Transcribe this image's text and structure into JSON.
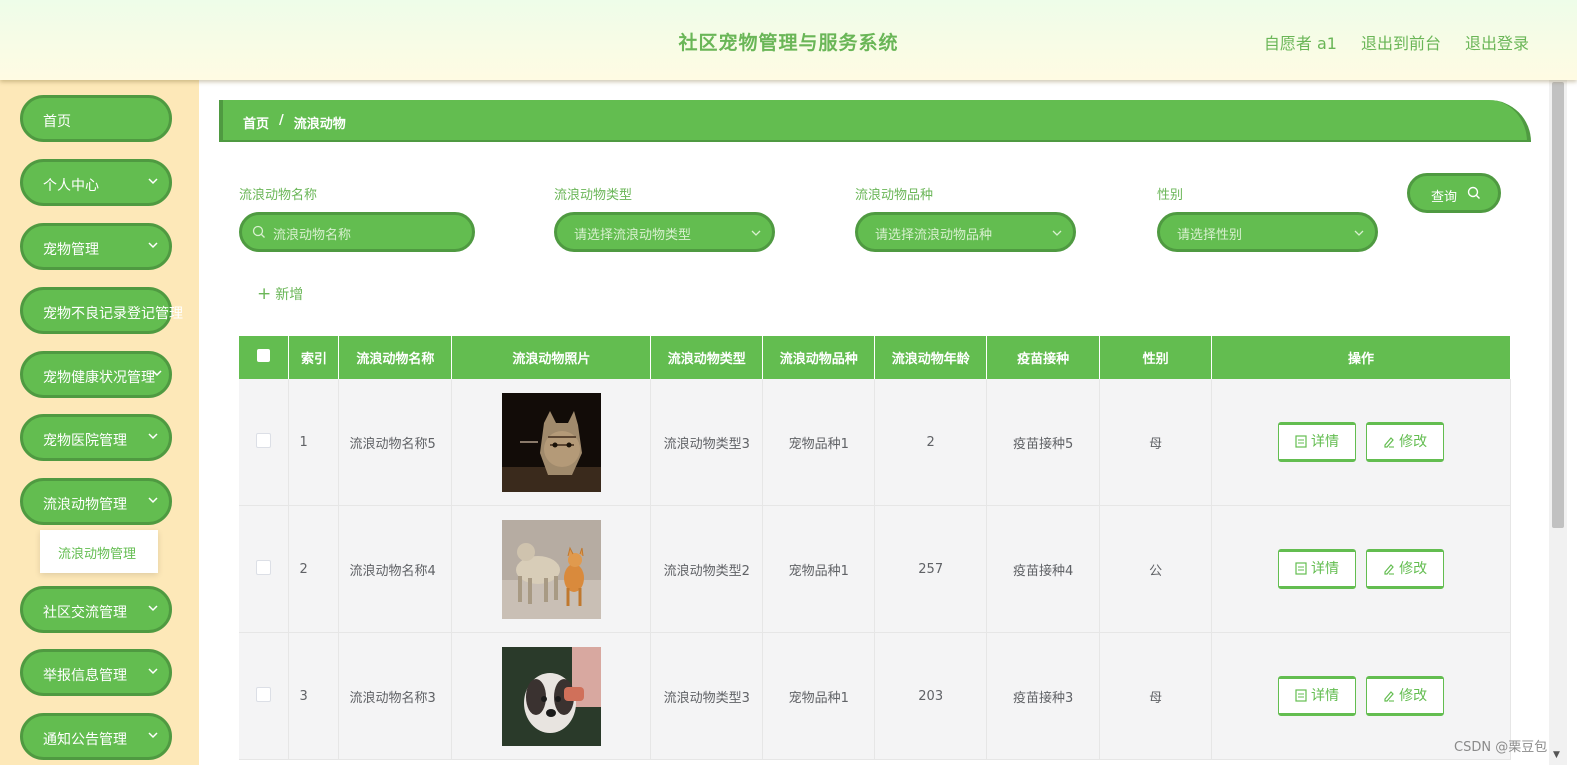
{
  "header": {
    "title": "社区宠物管理与服务系统",
    "user": "自愿者 a1",
    "to_front": "退出到前台",
    "logout": "退出登录"
  },
  "sidebar": {
    "items": [
      {
        "label": "首页",
        "has_children": false
      },
      {
        "label": "个人中心",
        "has_children": true
      },
      {
        "label": "宠物管理",
        "has_children": true
      },
      {
        "label": "宠物不良记录登记管理",
        "has_children": false
      },
      {
        "label": "宠物健康状况管理",
        "has_children": true
      },
      {
        "label": "宠物医院管理",
        "has_children": true
      },
      {
        "label": "流浪动物管理",
        "has_children": true
      },
      {
        "label": "社区交流管理",
        "has_children": true
      },
      {
        "label": "举报信息管理",
        "has_children": true
      },
      {
        "label": "通知公告管理",
        "has_children": true
      }
    ],
    "submenu_active": "流浪动物管理"
  },
  "breadcrumb": {
    "home": "首页",
    "sep": "/",
    "current": "流浪动物"
  },
  "search": {
    "name": {
      "label": "流浪动物名称",
      "placeholder": "流浪动物名称"
    },
    "type": {
      "label": "流浪动物类型",
      "placeholder": "请选择流浪动物类型"
    },
    "breed": {
      "label": "流浪动物品种",
      "placeholder": "请选择流浪动物品种"
    },
    "gender": {
      "label": "性别",
      "placeholder": "请选择性别"
    },
    "query": "查询"
  },
  "add_label": "新增",
  "table": {
    "headers": [
      "索引",
      "流浪动物名称",
      "流浪动物照片",
      "流浪动物类型",
      "流浪动物品种",
      "流浪动物年龄",
      "疫苗接种",
      "性别",
      "操作"
    ],
    "rows": [
      {
        "index": "1",
        "name": "流浪动物名称5",
        "type": "流浪动物类型3",
        "breed": "宠物品种1",
        "age": "2",
        "vaccine": "疫苗接种5",
        "gender": "母",
        "photo": "cat-photo"
      },
      {
        "index": "2",
        "name": "流浪动物名称4",
        "type": "流浪动物类型2",
        "breed": "宠物品种1",
        "age": "257",
        "vaccine": "疫苗接种4",
        "gender": "公",
        "photo": "dog-and-cat-photo"
      },
      {
        "index": "3",
        "name": "流浪动物名称3",
        "type": "流浪动物类型3",
        "breed": "宠物品种1",
        "age": "203",
        "vaccine": "疫苗接种3",
        "gender": "母",
        "photo": "dog-photo"
      }
    ],
    "detail_label": "详情",
    "edit_label": "修改"
  },
  "watermark": "CSDN @栗豆包",
  "colors": {
    "primary": "#63bd50",
    "primary_dark": "#4f9a41",
    "sidebar_bg": "#fde8b8"
  }
}
